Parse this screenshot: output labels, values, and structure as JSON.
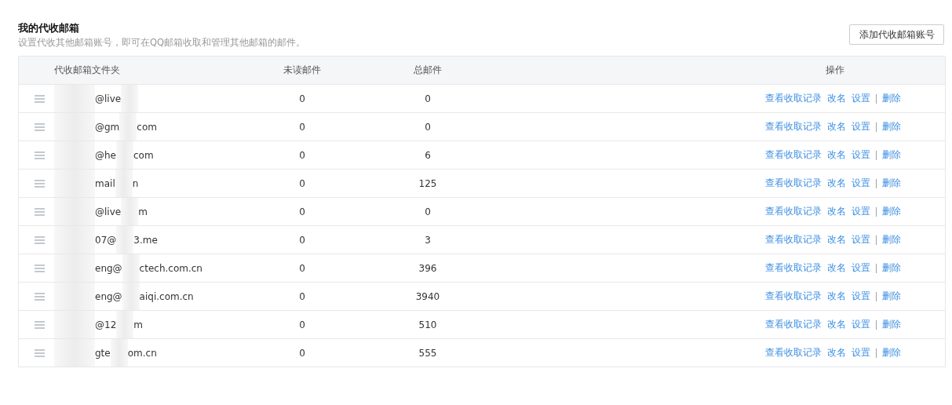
{
  "title": "我的代收邮箱",
  "subtitle": "设置代收其他邮箱账号，即可在QQ邮箱收取和管理其他邮箱的邮件。",
  "add_button": "添加代收邮箱账号",
  "columns": [
    "代收邮箱文件夹",
    "未读邮件",
    "总邮件",
    "操作"
  ],
  "rows": [
    {
      "email_parts": [
        "@live"
      ],
      "unread": "0",
      "total": "0",
      "actions": [
        "查看收取记录",
        "改名",
        "设置",
        "删除"
      ]
    },
    {
      "email_parts": [
        "@gm",
        "com"
      ],
      "unread": "0",
      "total": "0",
      "actions": [
        "查看收取记录",
        "改名",
        "设置",
        "删除"
      ]
    },
    {
      "email_parts": [
        "@he",
        "com"
      ],
      "unread": "0",
      "total": "6",
      "actions": [
        "查看收取记录",
        "改名",
        "设置",
        "删除"
      ]
    },
    {
      "email_parts": [
        "mail",
        "n"
      ],
      "unread": "0",
      "total": "125",
      "actions": [
        "查看收取记录",
        "改名",
        "设置",
        "删除"
      ]
    },
    {
      "email_parts": [
        "@live",
        "m"
      ],
      "unread": "0",
      "total": "0",
      "actions": [
        "查看收取记录",
        "改名",
        "设置",
        "删除"
      ]
    },
    {
      "email_parts": [
        "07@",
        "3.me"
      ],
      "unread": "0",
      "total": "3",
      "actions": [
        "查看收取记录",
        "改名",
        "设置",
        "删除"
      ]
    },
    {
      "email_parts": [
        "eng@",
        "ctech.com.cn"
      ],
      "unread": "0",
      "total": "396",
      "actions": [
        "查看收取记录",
        "改名",
        "设置",
        "删除"
      ]
    },
    {
      "email_parts": [
        "eng@",
        "aiqi.com.cn"
      ],
      "unread": "0",
      "total": "3940",
      "actions": [
        "查看收取记录",
        "改名",
        "设置",
        "删除"
      ]
    },
    {
      "email_parts": [
        "@12",
        "m"
      ],
      "unread": "0",
      "total": "510",
      "actions": [
        "查看收取记录",
        "改名",
        "设置",
        "删除"
      ]
    },
    {
      "email_parts": [
        "gte",
        "om.cn"
      ],
      "unread": "0",
      "total": "555",
      "actions": [
        "查看收取记录",
        "改名",
        "设置",
        "删除"
      ]
    }
  ]
}
